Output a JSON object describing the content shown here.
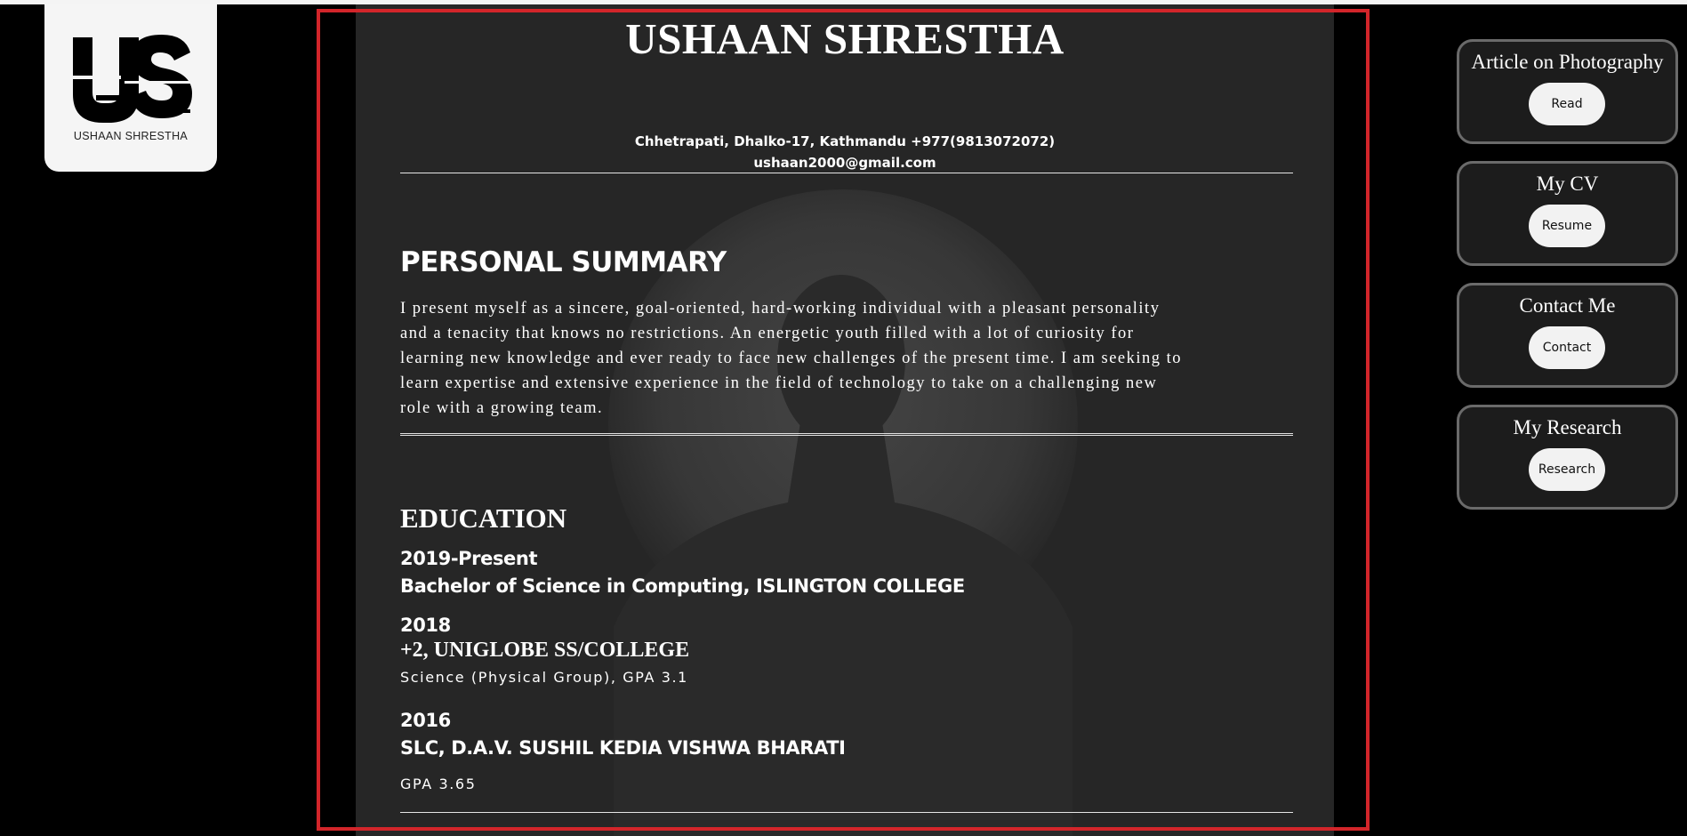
{
  "logo": {
    "monogram": "US",
    "caption": "USHAAN SHRESTHA"
  },
  "cv": {
    "name": "USHAAN SHRESTHA",
    "address_line": "Chhetrapati, Dhalko-17, Kathmandu +977(9813072072)",
    "email": "ushaan2000@gmail.com",
    "summary": {
      "heading": "PERSONAL SUMMARY",
      "lines": [
        "I present myself as a sincere, goal-oriented, hard-working individual with a pleasant personality",
        "and a tenacity that knows no restrictions. An energetic youth filled with a lot of curiosity for",
        "learning new knowledge and ever ready to face new challenges of the present time. I am seeking to",
        "learn expertise and extensive experience in the field of technology to take on a challenging new",
        "role with a growing team."
      ]
    },
    "education": {
      "heading": "EDUCATION",
      "entries": [
        {
          "year": "2019-Present",
          "title": "Bachelor of Science in Computing, ISLINGTON COLLEGE",
          "note": ""
        },
        {
          "year": "2018",
          "title": "+2, UNIGLOBE SS/COLLEGE",
          "note": "Science (Physical Group), GPA 3.1"
        },
        {
          "year": "2016",
          "title": "SLC, D.A.V. SUSHIL KEDIA VISHWA BHARATI",
          "note": "GPA 3.65"
        }
      ]
    }
  },
  "nav_cards": [
    {
      "title": "Article on Photography",
      "button": "Read"
    },
    {
      "title": "My CV",
      "button": "Resume"
    },
    {
      "title": "Contact Me",
      "button": "Contact"
    },
    {
      "title": "My Research",
      "button": "Research"
    }
  ],
  "colors": {
    "highlight_border": "#d2252a",
    "panel_bg": "#262626",
    "page_bg": "#000000"
  }
}
